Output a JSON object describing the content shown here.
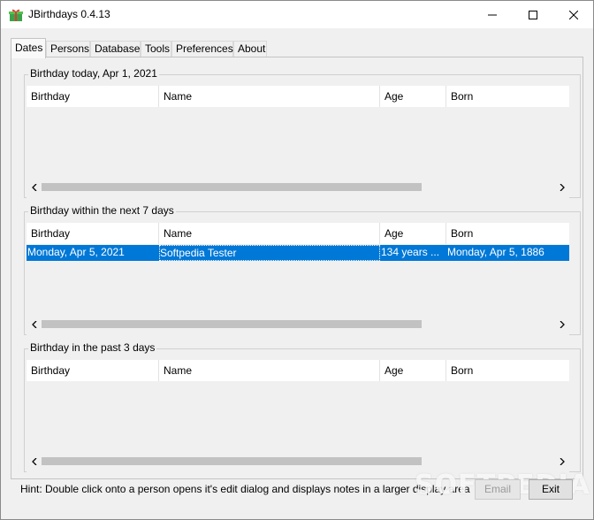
{
  "window": {
    "title": "JBirthdays 0.4.13"
  },
  "tabs": [
    {
      "label": "Dates",
      "active": true
    },
    {
      "label": "Persons",
      "active": false
    },
    {
      "label": "Database",
      "active": false
    },
    {
      "label": "Tools",
      "active": false
    },
    {
      "label": "Preferences",
      "active": false
    },
    {
      "label": "About",
      "active": false
    }
  ],
  "columns": [
    "Birthday",
    "Name",
    "Age",
    "Born"
  ],
  "groups": [
    {
      "title": "Birthday today, Apr 1, 2021",
      "rows": []
    },
    {
      "title": "Birthday within the next 7 days",
      "rows": [
        {
          "birthday": "Monday, Apr 5, 2021",
          "name": "Softpedia Tester",
          "age": "134 years ...",
          "born": "Monday, Apr 5, 1886",
          "selected": true
        }
      ]
    },
    {
      "title": "Birthday in the past 3 days",
      "rows": []
    }
  ],
  "footer": {
    "hint": "Hint: Double click onto a person opens it's edit dialog and displays notes in a larger display area",
    "email_label": "Email",
    "exit_label": "Exit",
    "watermark": "SOFTPEDIA"
  },
  "colors": {
    "selection": "#0078d7",
    "window_bg": "#f0f0f0"
  }
}
